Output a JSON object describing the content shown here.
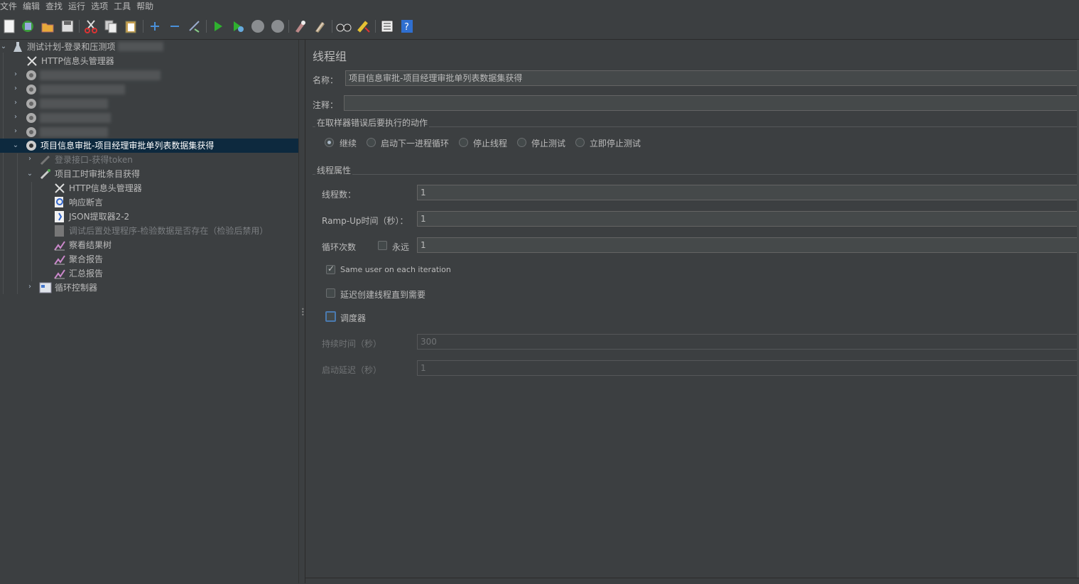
{
  "menu": [
    "文件",
    "编辑",
    "查找",
    "运行",
    "选项",
    "工具",
    "帮助"
  ],
  "toolbar": [
    "new-icon",
    "templates-icon",
    "open-icon",
    "save-icon",
    "cut-icon",
    "copy-icon",
    "paste-icon",
    "expand-icon",
    "collapse-icon",
    "toggle-icon",
    "start-icon",
    "start-no-pause-icon",
    "stop-icon",
    "shutdown-icon",
    "clear-icon",
    "clear-all-icon",
    "search-icon",
    "reset-search-icon",
    "function-helper-icon",
    "help-icon"
  ],
  "tree": {
    "root": "测试计划-登录和压测项",
    "header_manager": "HTTP信息头管理器",
    "selected_group": "项目信息审批-项目经理审批单列表数据集获得",
    "login": "登录接口-获得token",
    "sampler": "项目工时审批条目获得",
    "sub_header": "HTTP信息头管理器",
    "assert": "响应断言",
    "json": "JSON提取器2-2",
    "debug": "调试后置处理程序-检验数据是否存在（检验后禁用）",
    "results_tree": "察看结果树",
    "aggregate": "聚合报告",
    "summary": "汇总报告",
    "loop": "循环控制器"
  },
  "panel": {
    "title": "线程组",
    "name_label": "名称：",
    "name_value": "项目信息审批-项目经理审批单列表数据集获得",
    "comment_label": "注释：",
    "comment_value": "",
    "error_group": "在取样器错误后要执行的动作",
    "actions": [
      "继续",
      "启动下一进程循环",
      "停止线程",
      "停止测试",
      "立即停止测试"
    ],
    "selected_action": "继续",
    "props_group": "线程属性",
    "threads_label": "线程数：",
    "threads_value": "1",
    "rampup_label": "Ramp-Up时间（秒）：",
    "rampup_value": "1",
    "loop_label": "循环次数",
    "forever_label": "永远",
    "forever_checked": false,
    "loop_value": "1",
    "same_user_label": "Same user on each iteration",
    "same_user_checked": true,
    "delay_label": "延迟创建线程直到需要",
    "delay_checked": false,
    "scheduler_label": "调度器",
    "scheduler_checked": false,
    "duration_label": "持续时间（秒）",
    "duration_value": "300",
    "startup_label": "启动延迟（秒）",
    "startup_value": "1"
  }
}
